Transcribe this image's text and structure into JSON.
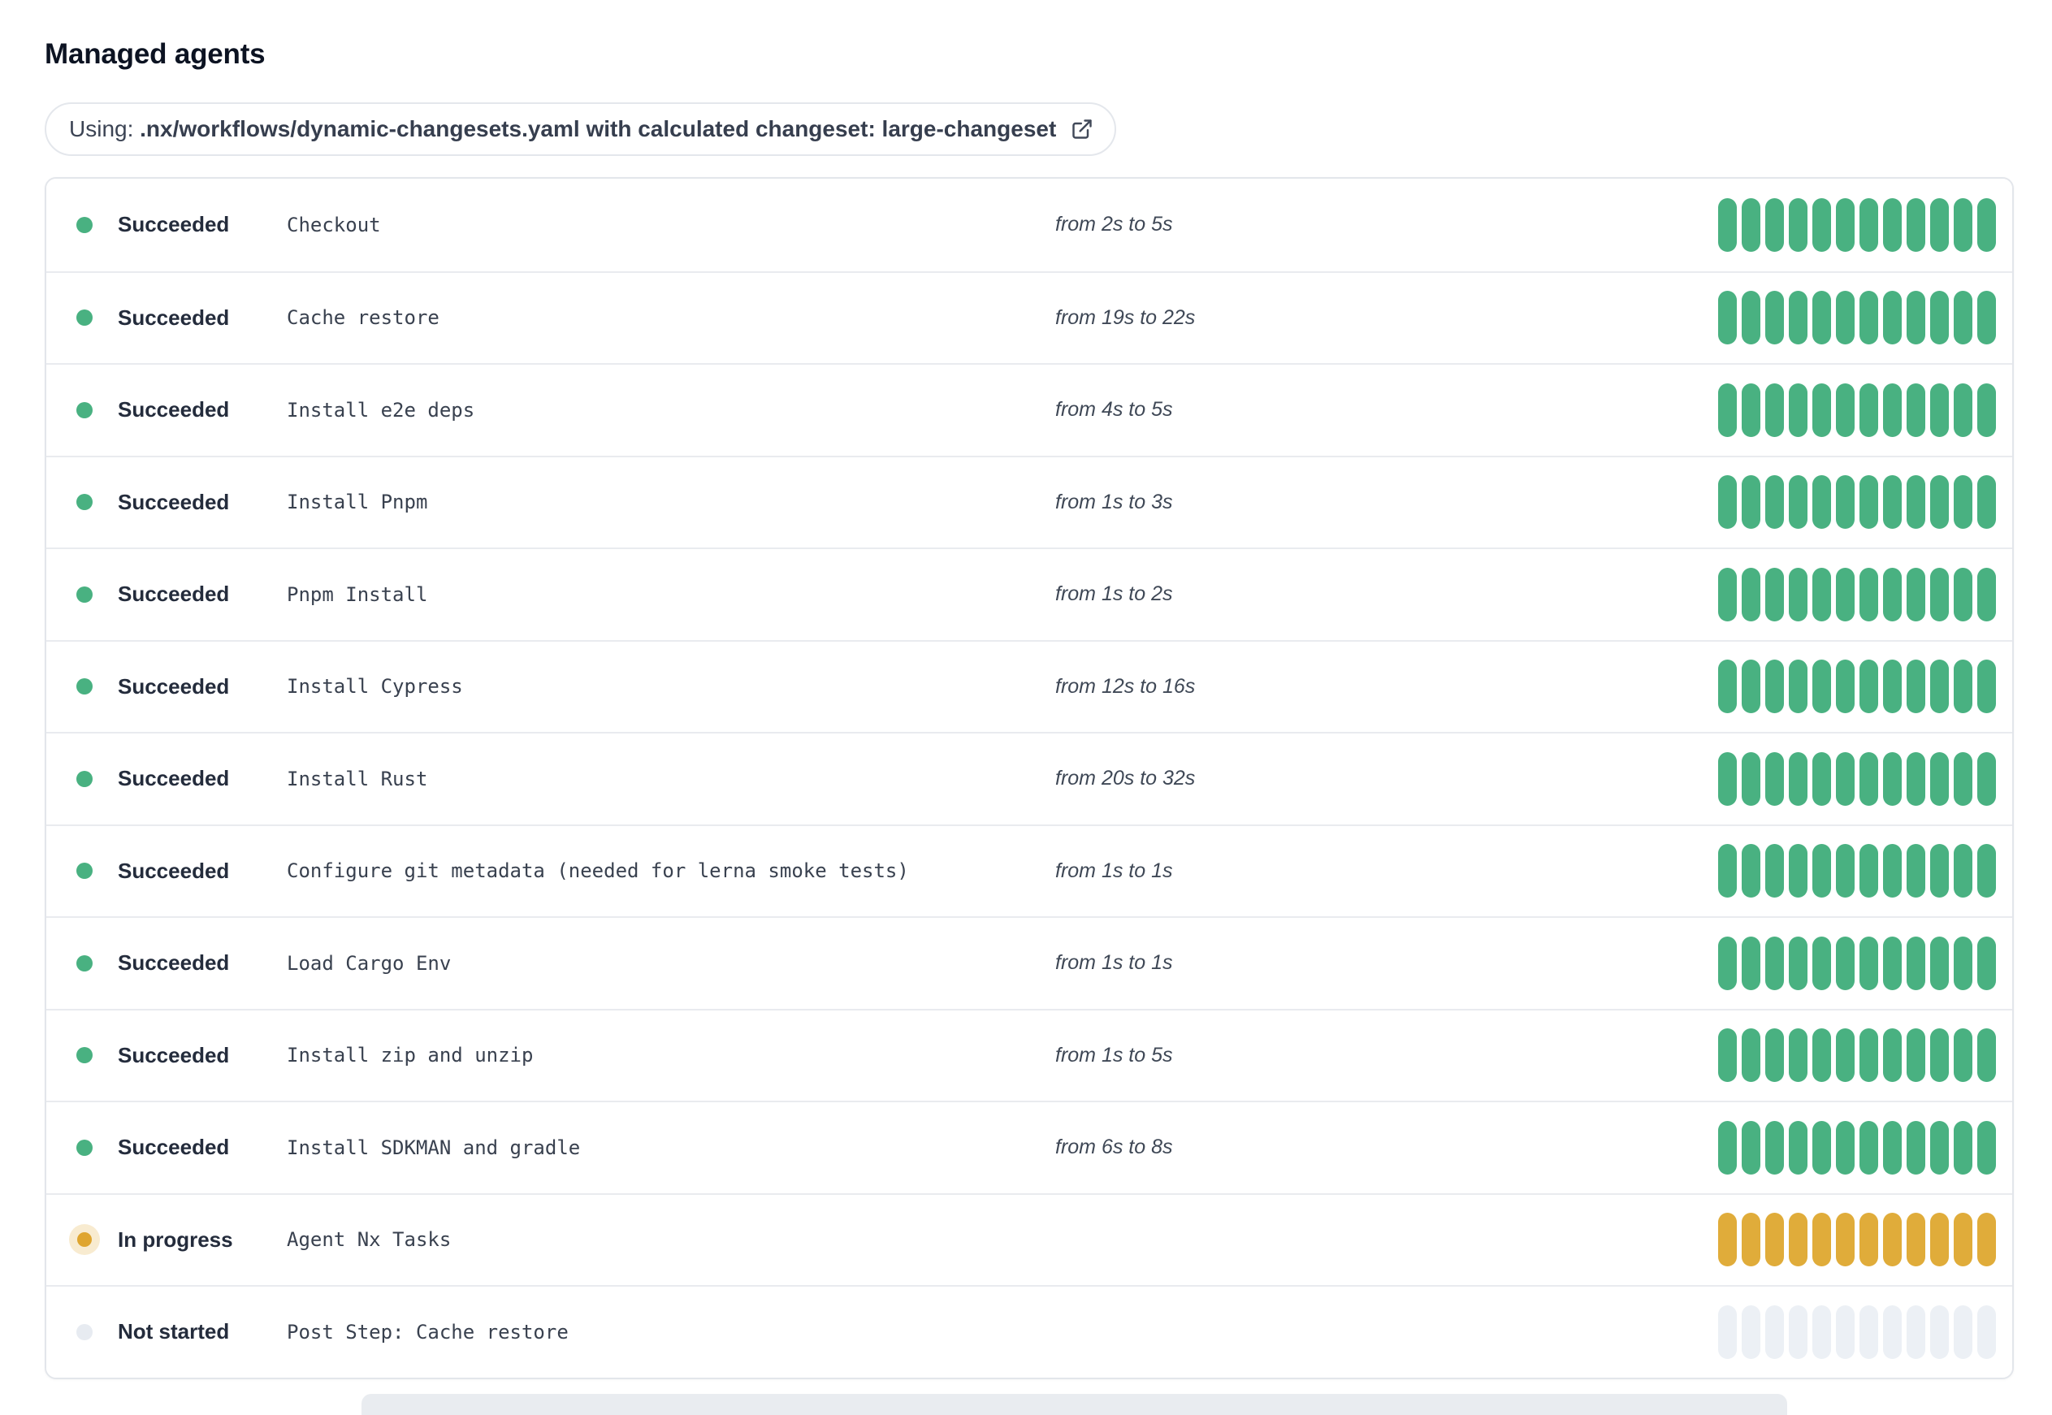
{
  "page": {
    "title": "Managed agents"
  },
  "config_badge": {
    "prefix": "Using:",
    "path": ".nx/workflows/dynamic-changesets.yaml with calculated changeset: large-changeset",
    "icon": "external-link-icon"
  },
  "colors": {
    "succeeded": "#49b181",
    "in_progress_bar": "#e0ac3a",
    "in_progress_dot": "#dfa52f",
    "in_progress_halo": "rgba(224,172,58,0.24)",
    "not_started_bar": "#ecf0f5",
    "not_started_dot": "#e7ebf1",
    "divider": "#e9ebef",
    "card_border": "#e3e6eb",
    "next_section": "#e9ecf0"
  },
  "agents": {
    "segments_per_bar": 12,
    "rows": [
      {
        "status": "Succeeded",
        "status_key": "succeeded",
        "step": "Checkout",
        "duration": "from 2s to 5s"
      },
      {
        "status": "Succeeded",
        "status_key": "succeeded",
        "step": "Cache restore",
        "duration": "from 19s to 22s"
      },
      {
        "status": "Succeeded",
        "status_key": "succeeded",
        "step": "Install e2e deps",
        "duration": "from 4s to 5s"
      },
      {
        "status": "Succeeded",
        "status_key": "succeeded",
        "step": "Install Pnpm",
        "duration": "from 1s to 3s"
      },
      {
        "status": "Succeeded",
        "status_key": "succeeded",
        "step": "Pnpm Install",
        "duration": "from 1s to 2s"
      },
      {
        "status": "Succeeded",
        "status_key": "succeeded",
        "step": "Install Cypress",
        "duration": "from 12s to 16s"
      },
      {
        "status": "Succeeded",
        "status_key": "succeeded",
        "step": "Install Rust",
        "duration": "from 20s to 32s"
      },
      {
        "status": "Succeeded",
        "status_key": "succeeded",
        "step": "Configure git metadata (needed for lerna smoke tests)",
        "duration": "from 1s to 1s"
      },
      {
        "status": "Succeeded",
        "status_key": "succeeded",
        "step": "Load Cargo Env",
        "duration": "from 1s to 1s"
      },
      {
        "status": "Succeeded",
        "status_key": "succeeded",
        "step": "Install zip and unzip",
        "duration": "from 1s to 5s"
      },
      {
        "status": "Succeeded",
        "status_key": "succeeded",
        "step": "Install SDKMAN and gradle",
        "duration": "from 6s to 8s"
      },
      {
        "status": "In progress",
        "status_key": "in_progress",
        "step": "Agent Nx Tasks",
        "duration": ""
      },
      {
        "status": "Not started",
        "status_key": "not_started",
        "step": "Post Step: Cache restore",
        "duration": ""
      }
    ]
  }
}
